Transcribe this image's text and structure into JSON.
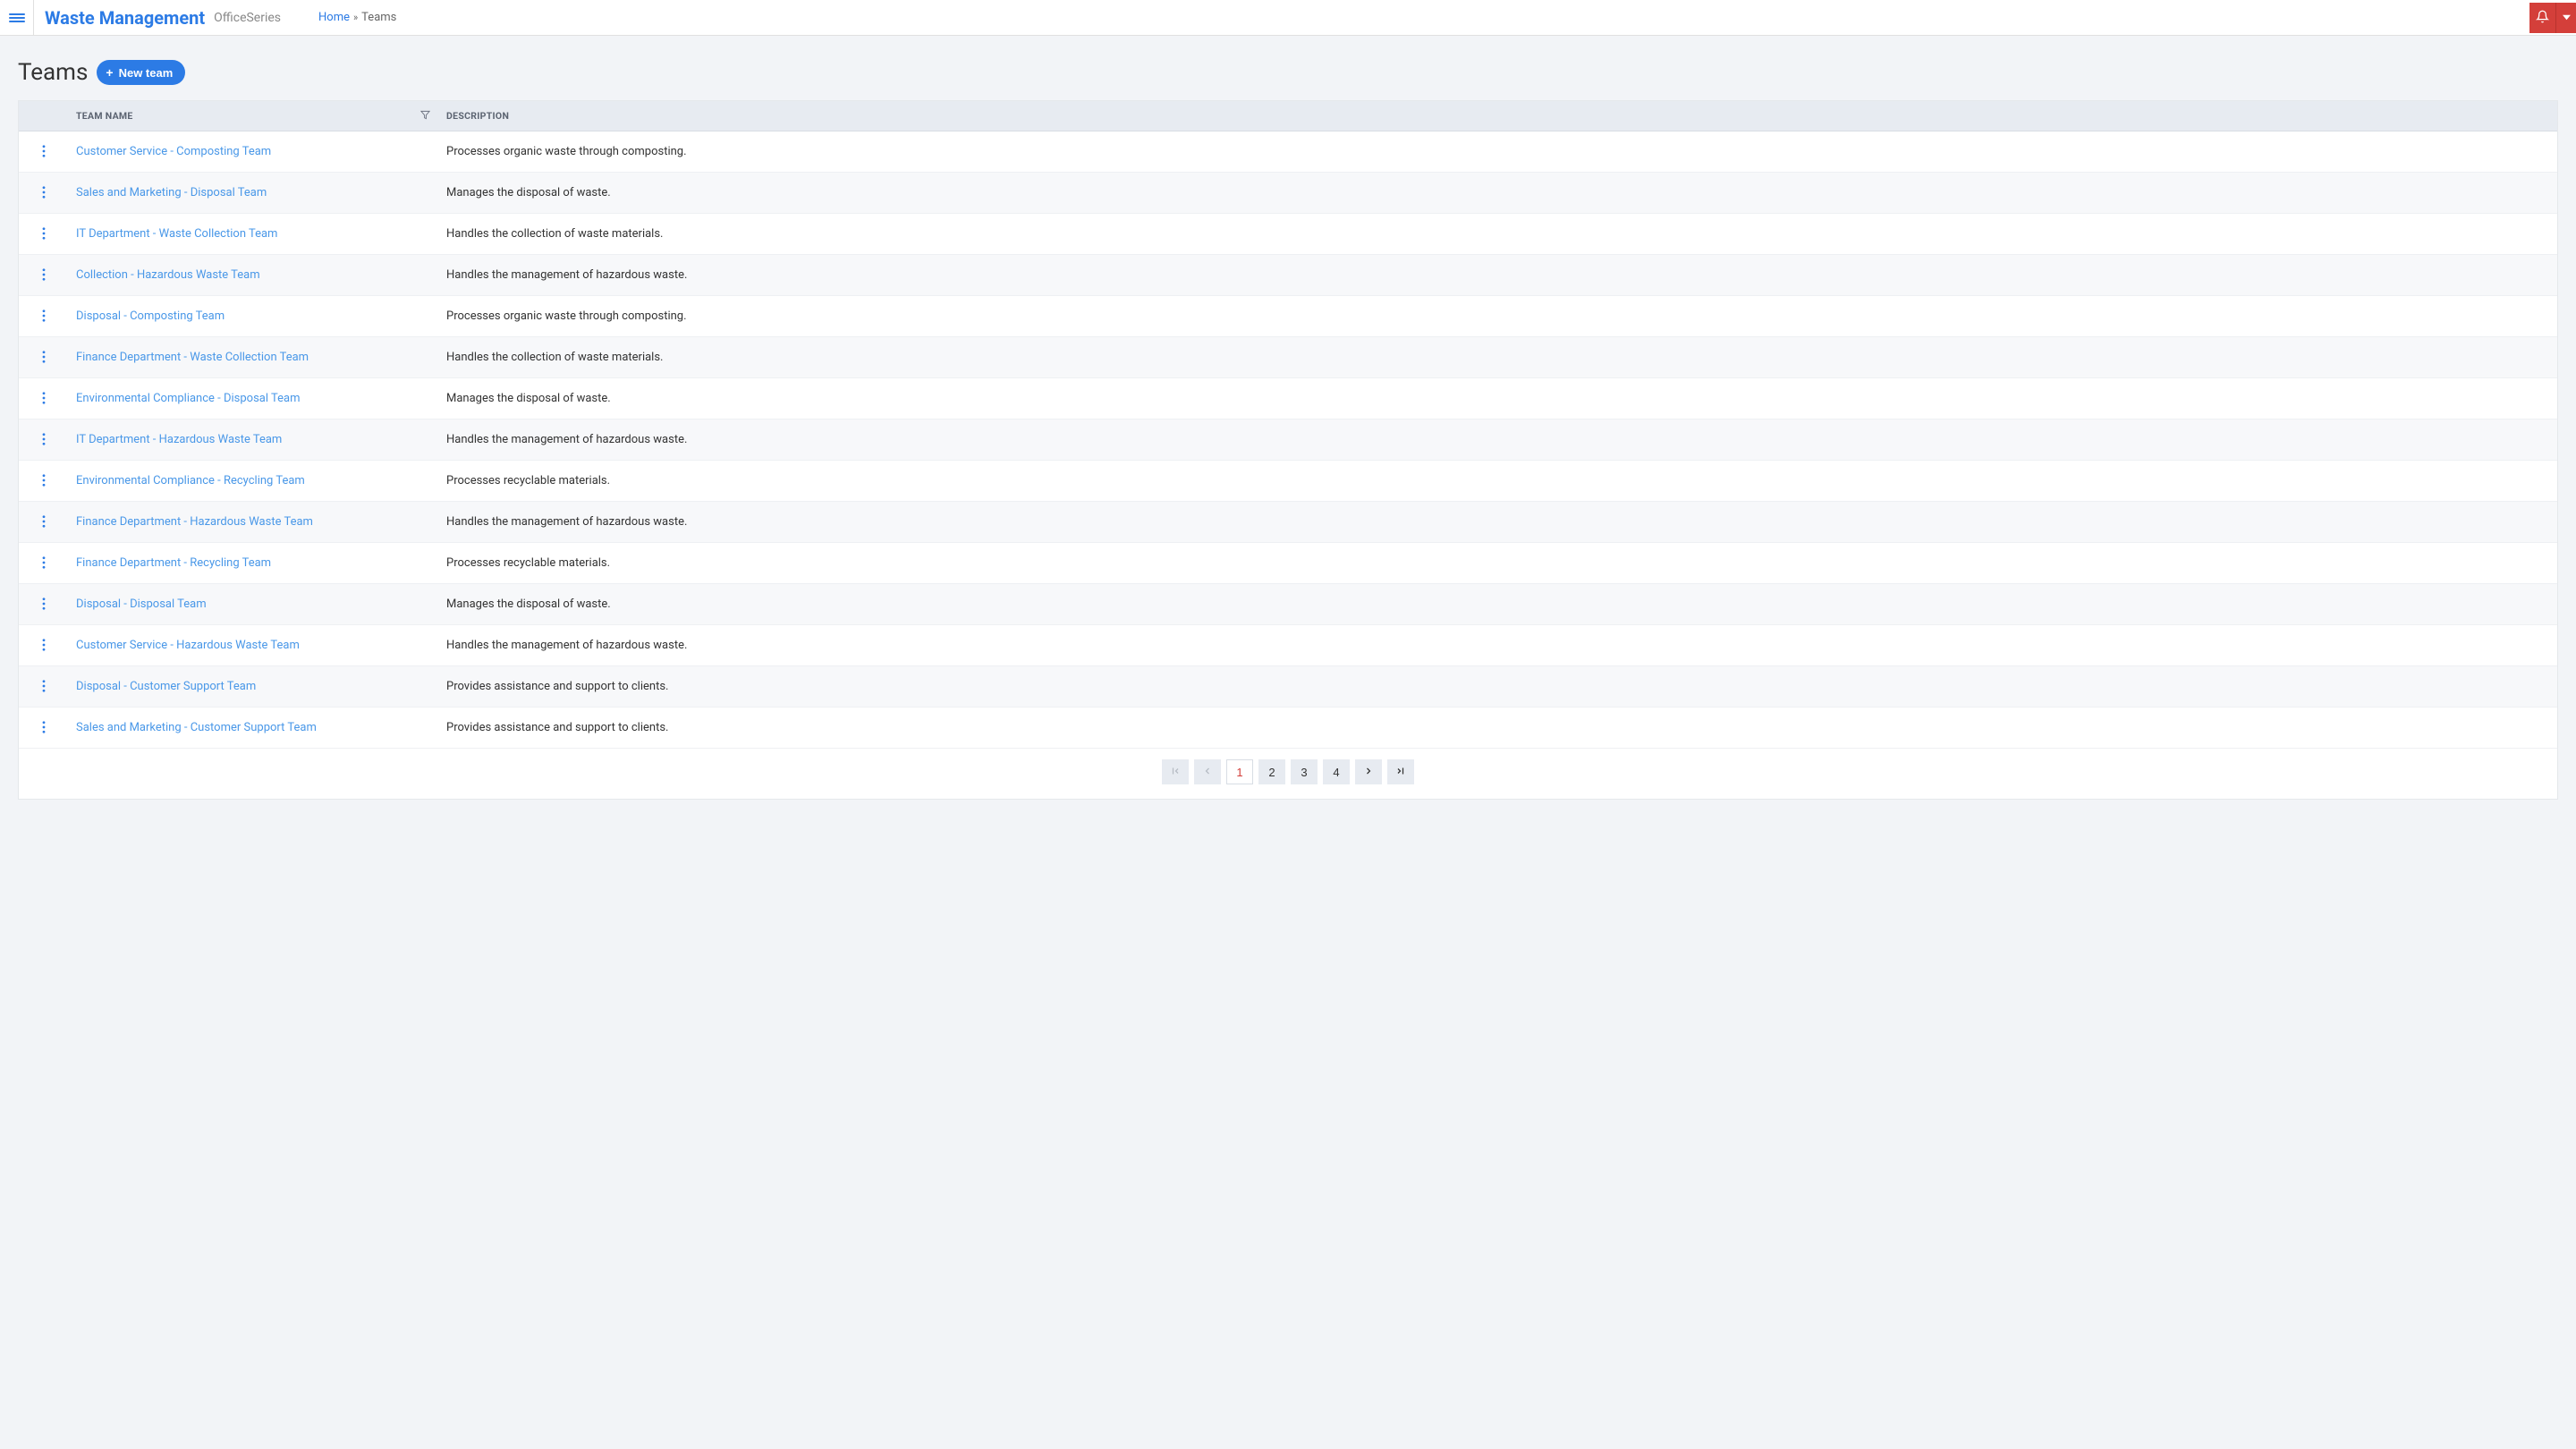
{
  "topbar": {
    "app_title": "Waste Management",
    "app_subtitle": "OfficeSeries",
    "breadcrumb_home": "Home",
    "breadcrumb_sep": "»",
    "breadcrumb_current": "Teams"
  },
  "header": {
    "page_title": "Teams",
    "new_button": "New team"
  },
  "table": {
    "col_name": "TEAM NAME",
    "col_desc": "DESCRIPTION",
    "rows": [
      {
        "name": "Customer Service - Composting Team",
        "desc": "Processes organic waste through composting."
      },
      {
        "name": "Sales and Marketing - Disposal Team",
        "desc": "Manages the disposal of waste."
      },
      {
        "name": "IT Department - Waste Collection Team",
        "desc": "Handles the collection of waste materials."
      },
      {
        "name": "Collection - Hazardous Waste Team",
        "desc": "Handles the management of hazardous waste."
      },
      {
        "name": "Disposal - Composting Team",
        "desc": "Processes organic waste through composting."
      },
      {
        "name": "Finance Department - Waste Collection Team",
        "desc": "Handles the collection of waste materials."
      },
      {
        "name": "Environmental Compliance - Disposal Team",
        "desc": "Manages the disposal of waste."
      },
      {
        "name": "IT Department - Hazardous Waste Team",
        "desc": "Handles the management of hazardous waste."
      },
      {
        "name": "Environmental Compliance - Recycling Team",
        "desc": "Processes recyclable materials."
      },
      {
        "name": "Finance Department - Hazardous Waste Team",
        "desc": "Handles the management of hazardous waste."
      },
      {
        "name": "Finance Department - Recycling Team",
        "desc": "Processes recyclable materials."
      },
      {
        "name": "Disposal - Disposal Team",
        "desc": "Manages the disposal of waste."
      },
      {
        "name": "Customer Service - Hazardous Waste Team",
        "desc": "Handles the management of hazardous waste."
      },
      {
        "name": "Disposal - Customer Support Team",
        "desc": "Provides assistance and support to clients."
      },
      {
        "name": "Sales and Marketing - Customer Support Team",
        "desc": "Provides assistance and support to clients."
      }
    ]
  },
  "pagination": {
    "pages": [
      "1",
      "2",
      "3",
      "4"
    ],
    "current": "1"
  }
}
